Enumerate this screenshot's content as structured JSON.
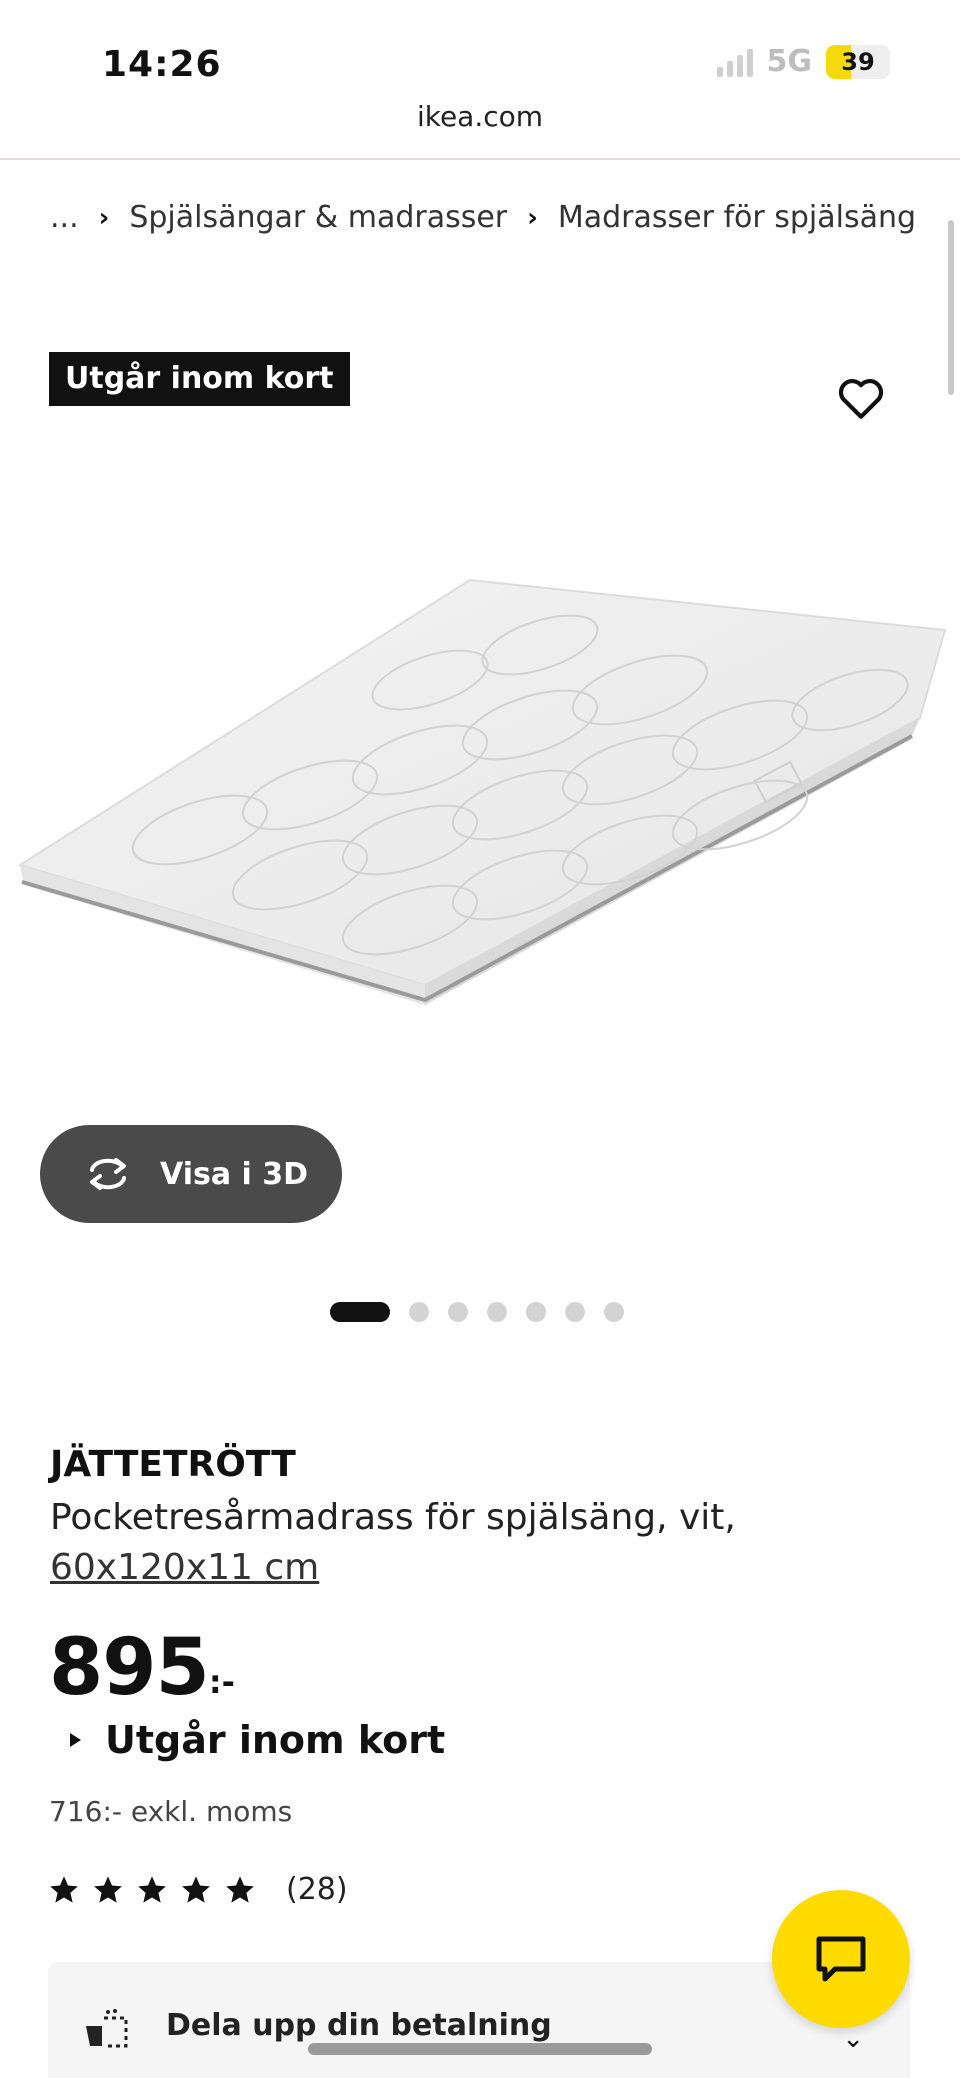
{
  "status_bar": {
    "time": "14:26",
    "network": "5G",
    "battery": "39",
    "battery_level": 0.39
  },
  "browser": {
    "url": "ikea.com"
  },
  "breadcrumb": {
    "ellipsis": "...",
    "items": [
      "Spjälsängar & madrasser",
      "Madrasser för spjälsäng"
    ]
  },
  "product": {
    "badge": "Utgår inom kort",
    "name": "JÄTTETRÖTT",
    "description": "Pocketresårmadrass för spjälsäng, vit,",
    "size": "60x120x11 cm",
    "price_main": "895",
    "price_suffix": ":-",
    "stock_status": "Utgår inom kort",
    "price_excl_vat": "716:- exkl. moms",
    "rating_stars": 5,
    "rating_count": "(28)"
  },
  "view3d": {
    "label": "Visa i 3D"
  },
  "carousel": {
    "total": 7,
    "active": 0
  },
  "payment": {
    "label": "Dela upp din betalning"
  },
  "icons": {
    "wishlist": "heart-icon",
    "view3d": "rotate-icon",
    "chat": "chat-bubble-icon",
    "payment": "split-payment-icon"
  },
  "colors": {
    "accent_yellow": "#ffdb00",
    "badge_bg": "#111111",
    "button_3d_bg": "#4a4a4a"
  }
}
